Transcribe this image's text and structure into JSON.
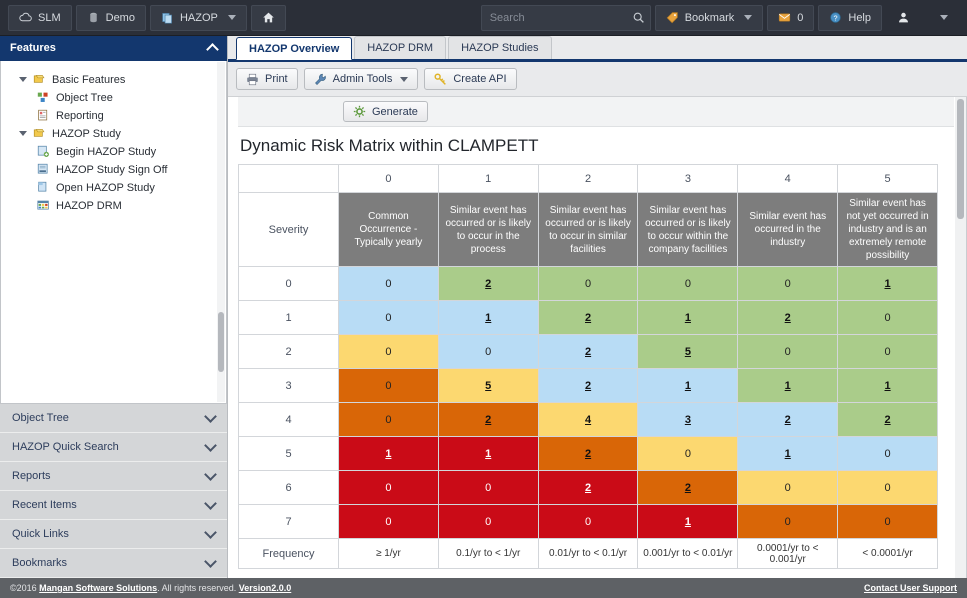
{
  "topbar": {
    "left_buttons": [
      {
        "name": "slm",
        "label": "SLM",
        "icon": "cloud-icon"
      },
      {
        "name": "demo",
        "label": "Demo",
        "icon": "database-icon"
      },
      {
        "name": "hazop",
        "label": "HAZOP",
        "icon": "documents-icon",
        "caret": true
      },
      {
        "name": "home",
        "label": "",
        "icon": "home-icon"
      }
    ],
    "search": {
      "value": "",
      "placeholder": "Search",
      "icon": "search-icon"
    },
    "bookmark": {
      "label": "Bookmark",
      "icon": "bookmark-tag-icon",
      "caret": true
    },
    "messages": {
      "count": "0",
      "icon": "mail-icon"
    },
    "help": {
      "label": "Help",
      "icon": "help-globe-icon"
    },
    "user": {
      "label": "",
      "icon": "user-icon",
      "caret": true
    }
  },
  "sidebar": {
    "panel_title": "Features",
    "tree": [
      {
        "label": "Basic Features",
        "level": 1,
        "twisty": true,
        "icon": "folder-yellow-icon"
      },
      {
        "label": "Object Tree",
        "level": 2,
        "twisty": false,
        "icon": "object-tree-icon"
      },
      {
        "label": "Reporting",
        "level": 2,
        "twisty": false,
        "icon": "report-icon"
      },
      {
        "label": "HAZOP Study",
        "level": 1,
        "twisty": true,
        "icon": "folder-yellow-icon"
      },
      {
        "label": "Begin HAZOP Study",
        "level": 2,
        "twisty": false,
        "icon": "begin-study-icon"
      },
      {
        "label": "HAZOP Study Sign Off",
        "level": 2,
        "twisty": false,
        "icon": "sign-off-icon"
      },
      {
        "label": "Open HAZOP Study",
        "level": 2,
        "twisty": false,
        "icon": "open-study-icon"
      },
      {
        "label": "HAZOP DRM",
        "level": 2,
        "twisty": false,
        "icon": "matrix-icon"
      }
    ],
    "accordions": [
      {
        "label": "Object Tree"
      },
      {
        "label": "HAZOP Quick Search"
      },
      {
        "label": "Reports"
      },
      {
        "label": "Recent Items"
      },
      {
        "label": "Quick Links"
      },
      {
        "label": "Bookmarks"
      }
    ]
  },
  "content": {
    "tabs": [
      {
        "label": "HAZOP Overview",
        "active": true
      },
      {
        "label": "HAZOP DRM",
        "active": false
      },
      {
        "label": "HAZOP Studies",
        "active": false
      }
    ],
    "toolbar": [
      {
        "name": "print",
        "label": "Print",
        "icon": "printer-icon",
        "caret": false
      },
      {
        "name": "admin-tools",
        "label": "Admin Tools",
        "icon": "wrench-icon",
        "caret": true
      },
      {
        "name": "create-api",
        "label": "Create API",
        "icon": "key-icon",
        "caret": false
      }
    ],
    "generate_button": {
      "label": "Generate",
      "icon": "gear-icon"
    },
    "page_title": "Dynamic Risk Matrix within CLAMPETT"
  },
  "chart_data": {
    "type": "heatmap",
    "title": "Dynamic Risk Matrix within CLAMPETT",
    "row_header_label": "Severity",
    "corner_label": "",
    "frequency_label": "Frequency",
    "columns": [
      "0",
      "1",
      "2",
      "3",
      "4",
      "5"
    ],
    "column_descriptions": [
      "Common Occurrence - Typically yearly",
      "Similar event has occurred or is likely to occur in the process",
      "Similar event has occurred or is likely to occur in similar facilities",
      "Similar event has occurred or is likely to occur within the company facilities",
      "Similar event has occurred in the industry",
      "Similar event has not yet occurred in industry and is an extremely remote possibility"
    ],
    "frequencies": [
      "≥ 1/yr",
      "0.1/yr to < 1/yr",
      "0.01/yr to < 0.1/yr",
      "0.001/yr to < 0.01/yr",
      "0.0001/yr to < 0.001/yr",
      "< 0.0001/yr"
    ],
    "rows": [
      "0",
      "1",
      "2",
      "3",
      "4",
      "5",
      "6",
      "7"
    ],
    "values": [
      [
        "0",
        "2",
        "0",
        "0",
        "0",
        "1"
      ],
      [
        "0",
        "1",
        "2",
        "1",
        "2",
        "0"
      ],
      [
        "0",
        "0",
        "2",
        "5",
        "0",
        "0"
      ],
      [
        "0",
        "5",
        "2",
        "1",
        "1",
        "1"
      ],
      [
        "0",
        "2",
        "4",
        "3",
        "2",
        "2"
      ],
      [
        "1",
        "1",
        "2",
        "0",
        "1",
        "0"
      ],
      [
        "0",
        "0",
        "2",
        "2",
        "0",
        "0"
      ],
      [
        "0",
        "0",
        "0",
        "1",
        "0",
        "0"
      ]
    ],
    "risk_levels": [
      [
        "blue",
        "green",
        "green",
        "green",
        "green",
        "green"
      ],
      [
        "blue",
        "blue",
        "green",
        "green",
        "green",
        "green"
      ],
      [
        "yellow",
        "blue",
        "blue",
        "green",
        "green",
        "green"
      ],
      [
        "orange",
        "yellow",
        "blue",
        "blue",
        "green",
        "green"
      ],
      [
        "orange",
        "orange",
        "yellow",
        "blue",
        "blue",
        "green"
      ],
      [
        "red",
        "red",
        "orange",
        "yellow",
        "blue",
        "blue"
      ],
      [
        "red",
        "red",
        "red",
        "orange",
        "yellow",
        "yellow"
      ],
      [
        "red",
        "red",
        "red",
        "red",
        "orange",
        "orange"
      ]
    ],
    "linked": [
      [
        false,
        true,
        false,
        false,
        false,
        true
      ],
      [
        false,
        true,
        true,
        true,
        true,
        false
      ],
      [
        false,
        false,
        true,
        true,
        false,
        false
      ],
      [
        false,
        true,
        true,
        true,
        true,
        true
      ],
      [
        false,
        true,
        true,
        true,
        true,
        true
      ],
      [
        true,
        true,
        true,
        false,
        true,
        false
      ],
      [
        false,
        false,
        true,
        true,
        false,
        false
      ],
      [
        false,
        false,
        false,
        true,
        false,
        false
      ]
    ],
    "colors": {
      "blue": "#b8dcf5",
      "green": "#aacc8a",
      "yellow": "#fcd870",
      "orange": "#d96607",
      "red": "#ca0b17",
      "header_gray": "#7d7d7d"
    }
  },
  "footer": {
    "copyright_prefix": "©2016 ",
    "company": "Mangan Software Solutions",
    "rights": ". All rights reserved. ",
    "version": "Version2.0.0",
    "support_link": "Contact User Support"
  }
}
